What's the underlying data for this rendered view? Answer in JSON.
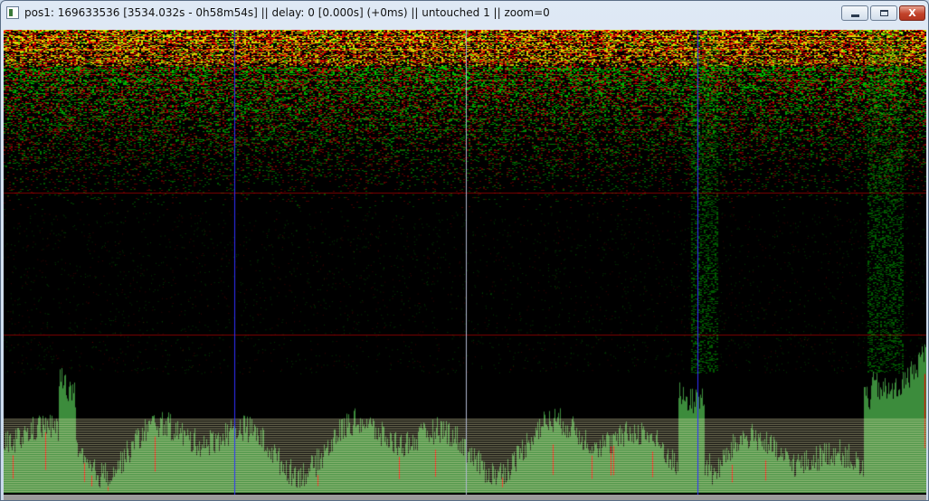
{
  "window": {
    "title": "pos1: 169633536 [3534.032s - 0h58m54s] || delay: 0 [0.000s] (+0ms) || untouched 1 || zoom=0",
    "app_icon": "spectrogram-app-icon",
    "controls": {
      "minimize_label": "",
      "maximize_label": "",
      "close_label": "X"
    }
  },
  "view": {
    "type": "stereo-spectrogram",
    "zoom": 0,
    "colors": {
      "left_channel": "#00ff00",
      "right_channel": "#ff0000",
      "overlap": "#ffff00",
      "background": "#000000",
      "waveform_fill": "#3c8c3c",
      "waveform_base": "#e8e4b0",
      "cursor_blue": "#3030ff",
      "cursor_white": "#b0b8d0"
    }
  }
}
